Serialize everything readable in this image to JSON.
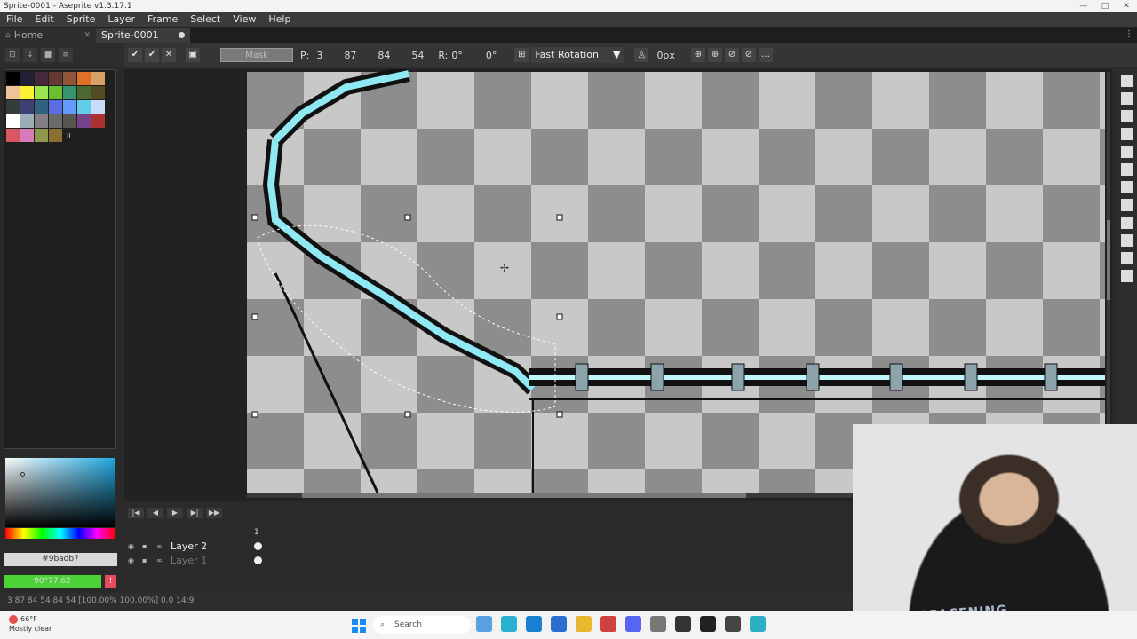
{
  "window": {
    "title": "Sprite-0001 - Aseprite v1.3.17.1"
  },
  "menu": [
    "File",
    "Edit",
    "Sprite",
    "Layer",
    "Frame",
    "Select",
    "View",
    "Help"
  ],
  "tabs": {
    "home": "Home",
    "sprite": "Sprite-0001"
  },
  "context_bar": {
    "mask_label": "Mask",
    "pos_x_label": "P:",
    "pos_x": "3",
    "pos_y": "87",
    "width": "84",
    "height": "54",
    "rotation_label": "R:",
    "rotation": "0°",
    "skew": "0°",
    "algorithm": "Fast Rotation",
    "pixels": "0px"
  },
  "palette": {
    "colors": [
      "#000000",
      "#222034",
      "#45283c",
      "#663931",
      "#8f563b",
      "#df7126",
      "#d9a066",
      "#eec39a",
      "#fbf236",
      "#99e550",
      "#6abe30",
      "#37946e",
      "#4b692f",
      "#524b24",
      "#323c39",
      "#3f3f74",
      "#306082",
      "#5b6ee1",
      "#639bff",
      "#5fcde4",
      "#cbdbfc",
      "#ffffff",
      "#9badb7",
      "#847e87",
      "#696a6a",
      "#595652",
      "#76428a",
      "#ac3232",
      "#d95763",
      "#d77bba",
      "#8f974a",
      "#8a6f30"
    ],
    "mark": "II"
  },
  "color": {
    "hex": "#9badb7",
    "alpha_label": "90°77.62"
  },
  "timeline": {
    "frame_number": "1",
    "layers": [
      {
        "name": "Layer 2",
        "active": true
      },
      {
        "name": "Layer 1",
        "active": false
      }
    ]
  },
  "status": {
    "text": "3 87  84 54  84 54 [100.00% 100.00%]  0.0  14:9"
  },
  "taskbar": {
    "weather_temp": "66°F",
    "weather_text": "Mostly clear",
    "search_placeholder": "Search"
  },
  "webcam": {
    "shirt_text": "SPACENING"
  }
}
